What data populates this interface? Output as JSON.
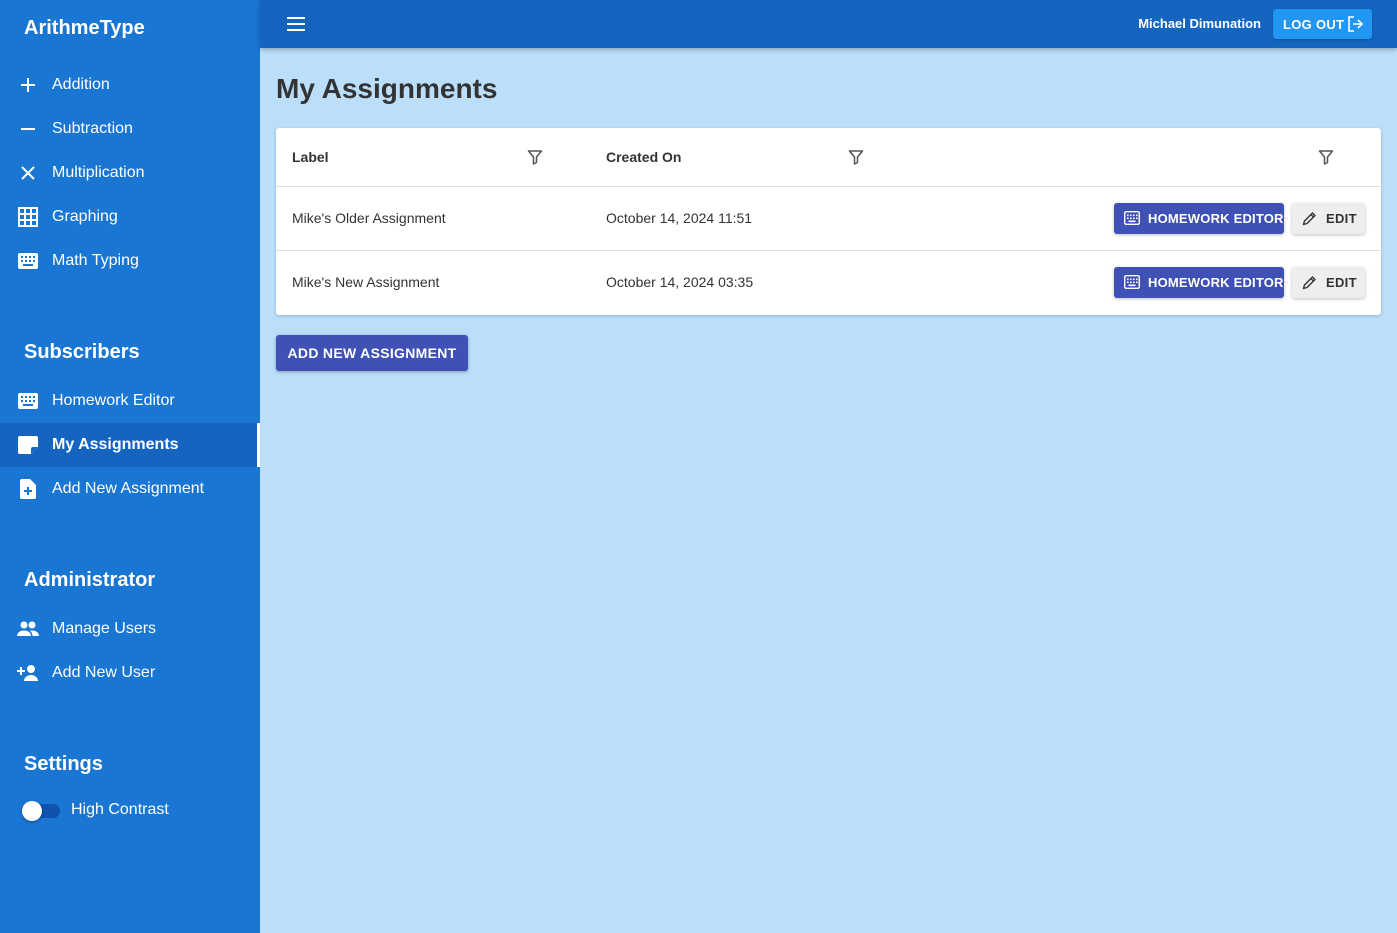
{
  "sidebar": {
    "brand": "ArithmeType",
    "main_items": [
      {
        "label": "Addition",
        "icon": "plus-icon"
      },
      {
        "label": "Subtraction",
        "icon": "minus-icon"
      },
      {
        "label": "Multiplication",
        "icon": "times-icon"
      },
      {
        "label": "Graphing",
        "icon": "grid-icon"
      },
      {
        "label": "Math Typing",
        "icon": "keyboard-icon"
      }
    ],
    "subscribers": {
      "heading": "Subscribers",
      "items": [
        {
          "label": "Homework Editor",
          "icon": "keyboard-icon"
        },
        {
          "label": "My Assignments",
          "icon": "note-icon",
          "active": true
        },
        {
          "label": "Add New Assignment",
          "icon": "file-add-icon"
        }
      ]
    },
    "administrator": {
      "heading": "Administrator",
      "items": [
        {
          "label": "Manage Users",
          "icon": "people-icon"
        },
        {
          "label": "Add New User",
          "icon": "person-add-icon"
        }
      ]
    },
    "settings": {
      "heading": "Settings",
      "high_contrast_label": "High Contrast",
      "high_contrast_on": false
    }
  },
  "topbar": {
    "username": "Michael Dimunation",
    "logout_label": "LOG OUT"
  },
  "main": {
    "title": "My Assignments",
    "table": {
      "columns": [
        "Label",
        "Created On",
        ""
      ],
      "rows": [
        {
          "label": "Mike's Older Assignment",
          "created_on": "October 14, 2024 11:51"
        },
        {
          "label": "Mike's New Assignment",
          "created_on": "October 14, 2024 03:35"
        }
      ],
      "homework_editor_label": "HOMEWORK EDITOR",
      "edit_label": "EDIT"
    },
    "add_button_label": "ADD NEW ASSIGNMENT"
  },
  "colors": {
    "sidebar": "#1976d2",
    "topbar": "#1565c0",
    "background": "#bbdefb",
    "primary_button": "#3f51b5",
    "logout_button": "#2196f3"
  }
}
